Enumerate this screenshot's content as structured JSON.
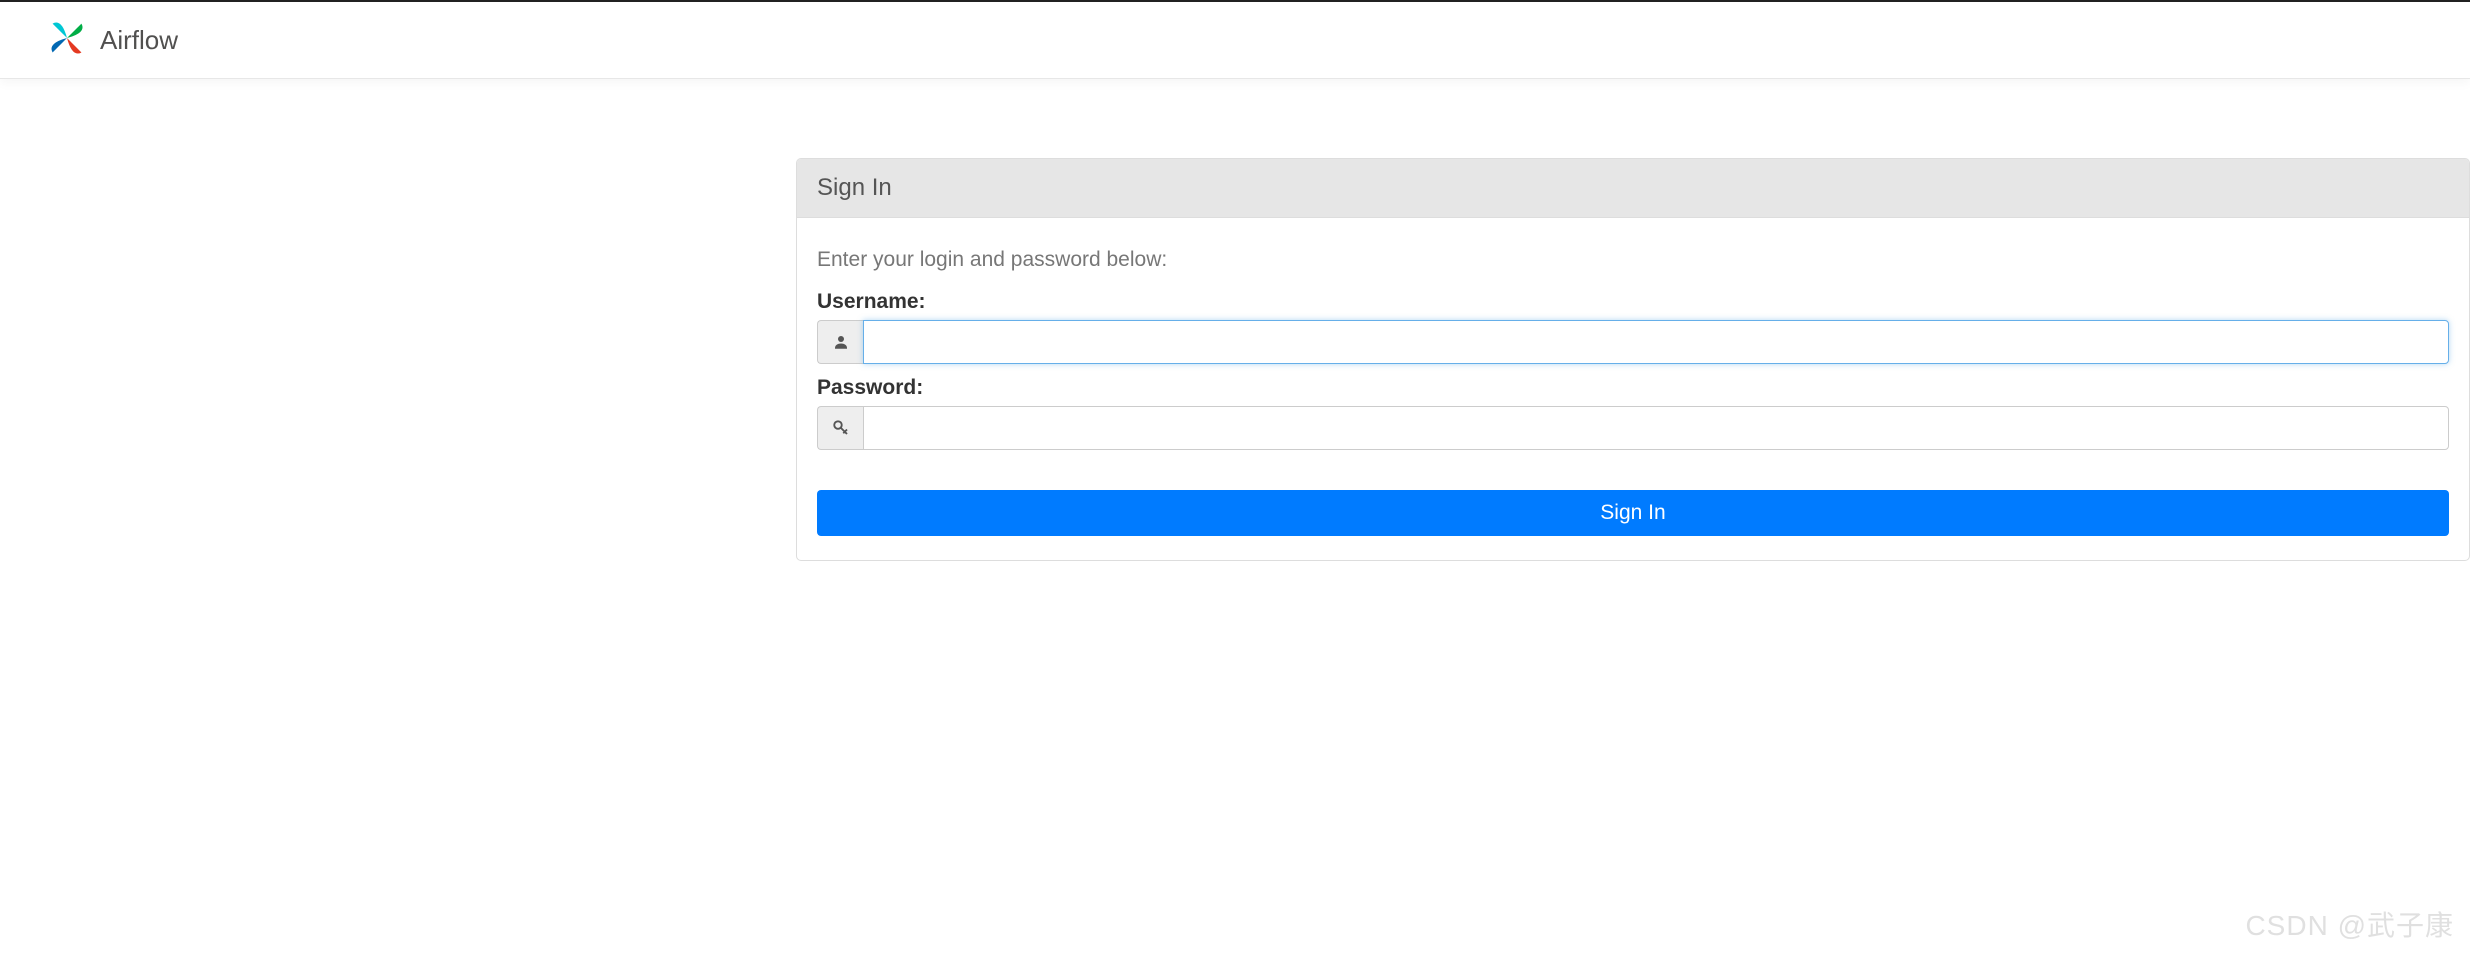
{
  "navbar": {
    "brand": "Airflow"
  },
  "login": {
    "panel_title": "Sign In",
    "instruction": "Enter your login and password below:",
    "username_label": "Username:",
    "username_value": "",
    "password_label": "Password:",
    "password_value": "",
    "submit_label": "Sign In"
  },
  "watermark": "CSDN @武子康"
}
